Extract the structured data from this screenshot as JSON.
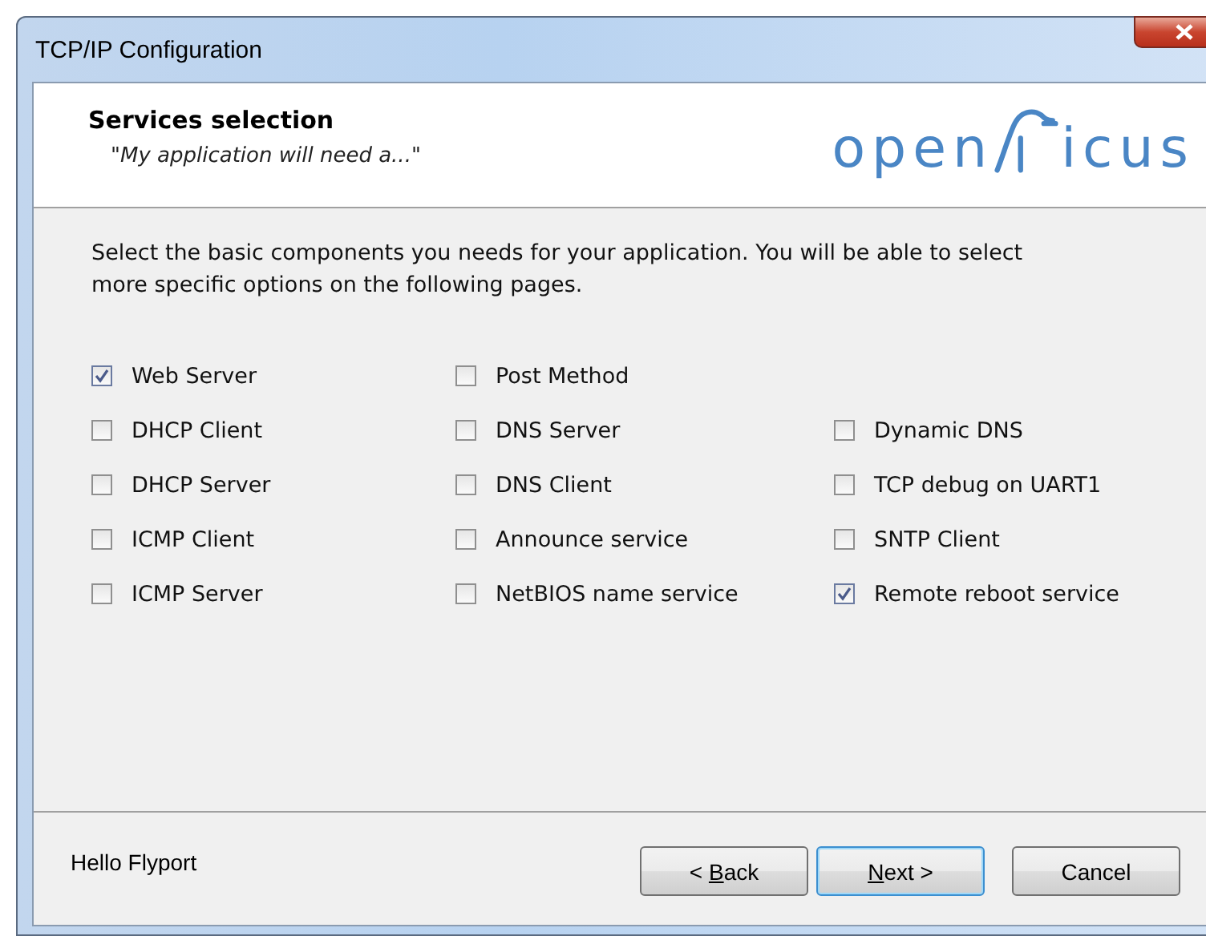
{
  "window": {
    "title": "TCP/IP Configuration"
  },
  "header": {
    "title": "Services selection",
    "subtitle": "\"My application will need a...\"",
    "logo": {
      "before": "open",
      "after": "icus"
    }
  },
  "description": "Select the basic components you needs for your application.  You will be able to select more specific options on the following pages.",
  "rows": [
    {
      "cells": [
        {
          "label": "Web Server",
          "checked": true
        },
        {
          "label": "Post Method",
          "checked": false
        }
      ]
    },
    {
      "cells": [
        {
          "label": "DHCP Client",
          "checked": false
        },
        {
          "label": "DNS Server",
          "checked": false
        },
        {
          "label": "Dynamic DNS",
          "checked": false
        }
      ]
    },
    {
      "cells": [
        {
          "label": "DHCP Server",
          "checked": false
        },
        {
          "label": "DNS Client",
          "checked": false
        },
        {
          "label": "TCP debug on UART1",
          "checked": false
        }
      ]
    },
    {
      "cells": [
        {
          "label": "ICMP Client",
          "checked": false
        },
        {
          "label": "Announce service",
          "checked": false
        },
        {
          "label": "SNTP Client",
          "checked": false
        }
      ]
    },
    {
      "cells": [
        {
          "label": "ICMP Server",
          "checked": false
        },
        {
          "label": "NetBIOS name service",
          "checked": false
        },
        {
          "label": "Remote reboot service",
          "checked": true
        }
      ]
    }
  ],
  "footer": {
    "label": "Hello Flyport",
    "buttons": [
      {
        "label": "< Back",
        "default": false,
        "access_key": true
      },
      {
        "label": "Next >",
        "default": true,
        "access_key": true
      },
      {
        "label": "Cancel",
        "default": false,
        "access_key": false
      }
    ]
  }
}
